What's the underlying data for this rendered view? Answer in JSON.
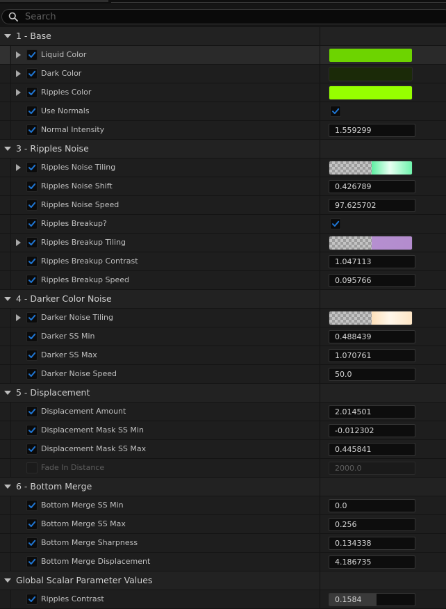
{
  "search": {
    "placeholder": "Search"
  },
  "colors": {
    "check": "#1f77d6",
    "panel": "#1e1e1e",
    "category": "#222222"
  },
  "categories": [
    {
      "title": "1 - Base",
      "rows": [
        {
          "label": "Liquid Color",
          "checked": true,
          "expandable": true,
          "highlighted": true,
          "type": "color",
          "color": "#6dd400"
        },
        {
          "label": "Dark Color",
          "checked": true,
          "expandable": true,
          "type": "color",
          "color": "#1b2a08"
        },
        {
          "label": "Ripples Color",
          "checked": true,
          "expandable": true,
          "type": "color",
          "color": "#96ff00"
        },
        {
          "label": "Use Normals",
          "checked": true,
          "type": "bool",
          "value": true
        },
        {
          "label": "Normal Intensity",
          "checked": true,
          "type": "number",
          "value": "1.559299"
        }
      ]
    },
    {
      "title": "3 - Ripples Noise",
      "rows": [
        {
          "label": "Ripples Noise Tiling",
          "checked": true,
          "expandable": true,
          "type": "gradient",
          "gradient": "linear-gradient(90deg,#5ef0a2 0%,#e8fff2 45%,#6ff4ad 100%)"
        },
        {
          "label": "Ripples Noise Shift",
          "checked": true,
          "type": "number",
          "value": "0.426789"
        },
        {
          "label": "Ripples Noise Speed",
          "checked": true,
          "type": "number",
          "value": "97.625702"
        },
        {
          "label": "Ripples Breakup?",
          "checked": true,
          "type": "bool",
          "value": true
        },
        {
          "label": "Ripples Breakup Tiling",
          "checked": true,
          "expandable": true,
          "type": "gradient",
          "gradient": "linear-gradient(90deg,#b58fd0 0%,#b48cce 100%)"
        },
        {
          "label": "Ripples Breakup Contrast",
          "checked": true,
          "type": "number",
          "value": "1.047113"
        },
        {
          "label": "Ripples Breakup Speed",
          "checked": true,
          "type": "number",
          "value": "0.095766"
        }
      ]
    },
    {
      "title": "4 - Darker Color Noise",
      "rows": [
        {
          "label": "Darker Noise Tiling",
          "checked": true,
          "expandable": true,
          "type": "gradient",
          "gradient": "linear-gradient(90deg,#fde0ba 0%,#fff7ea 45%,#fee6c6 100%)"
        },
        {
          "label": "Darker SS Min",
          "checked": true,
          "type": "number",
          "value": "0.488439"
        },
        {
          "label": "Darker SS Max",
          "checked": true,
          "type": "number",
          "value": "1.070761"
        },
        {
          "label": "Darker Noise Speed",
          "checked": true,
          "type": "number",
          "value": "50.0"
        }
      ]
    },
    {
      "title": "5 - Displacement",
      "rows": [
        {
          "label": "Displacement Amount",
          "checked": true,
          "type": "number",
          "value": "2.014501"
        },
        {
          "label": "Displacement Mask SS Min",
          "checked": true,
          "type": "number",
          "value": "-0.012302"
        },
        {
          "label": "Displacement Mask SS Max",
          "checked": true,
          "type": "number",
          "value": "0.445841"
        },
        {
          "label": "Fade In Distance",
          "checked": false,
          "disabled": true,
          "type": "number",
          "value": "2000.0"
        }
      ]
    },
    {
      "title": "6 - Bottom Merge",
      "rows": [
        {
          "label": "Bottom Merge SS Min",
          "checked": true,
          "type": "number",
          "value": "0.0"
        },
        {
          "label": "Bottom Merge SS Max",
          "checked": true,
          "type": "number",
          "value": "0.256"
        },
        {
          "label": "Bottom Merge Sharpness",
          "checked": true,
          "type": "number",
          "value": "0.134338"
        },
        {
          "label": "Bottom Merge Displacement",
          "checked": true,
          "type": "number",
          "value": "4.186735"
        }
      ]
    },
    {
      "title": "Global Scalar Parameter Values",
      "rows": [
        {
          "label": "Ripples Contrast",
          "checked": true,
          "type": "slider",
          "value": "0.1584",
          "fraction": 0.55
        }
      ]
    }
  ]
}
